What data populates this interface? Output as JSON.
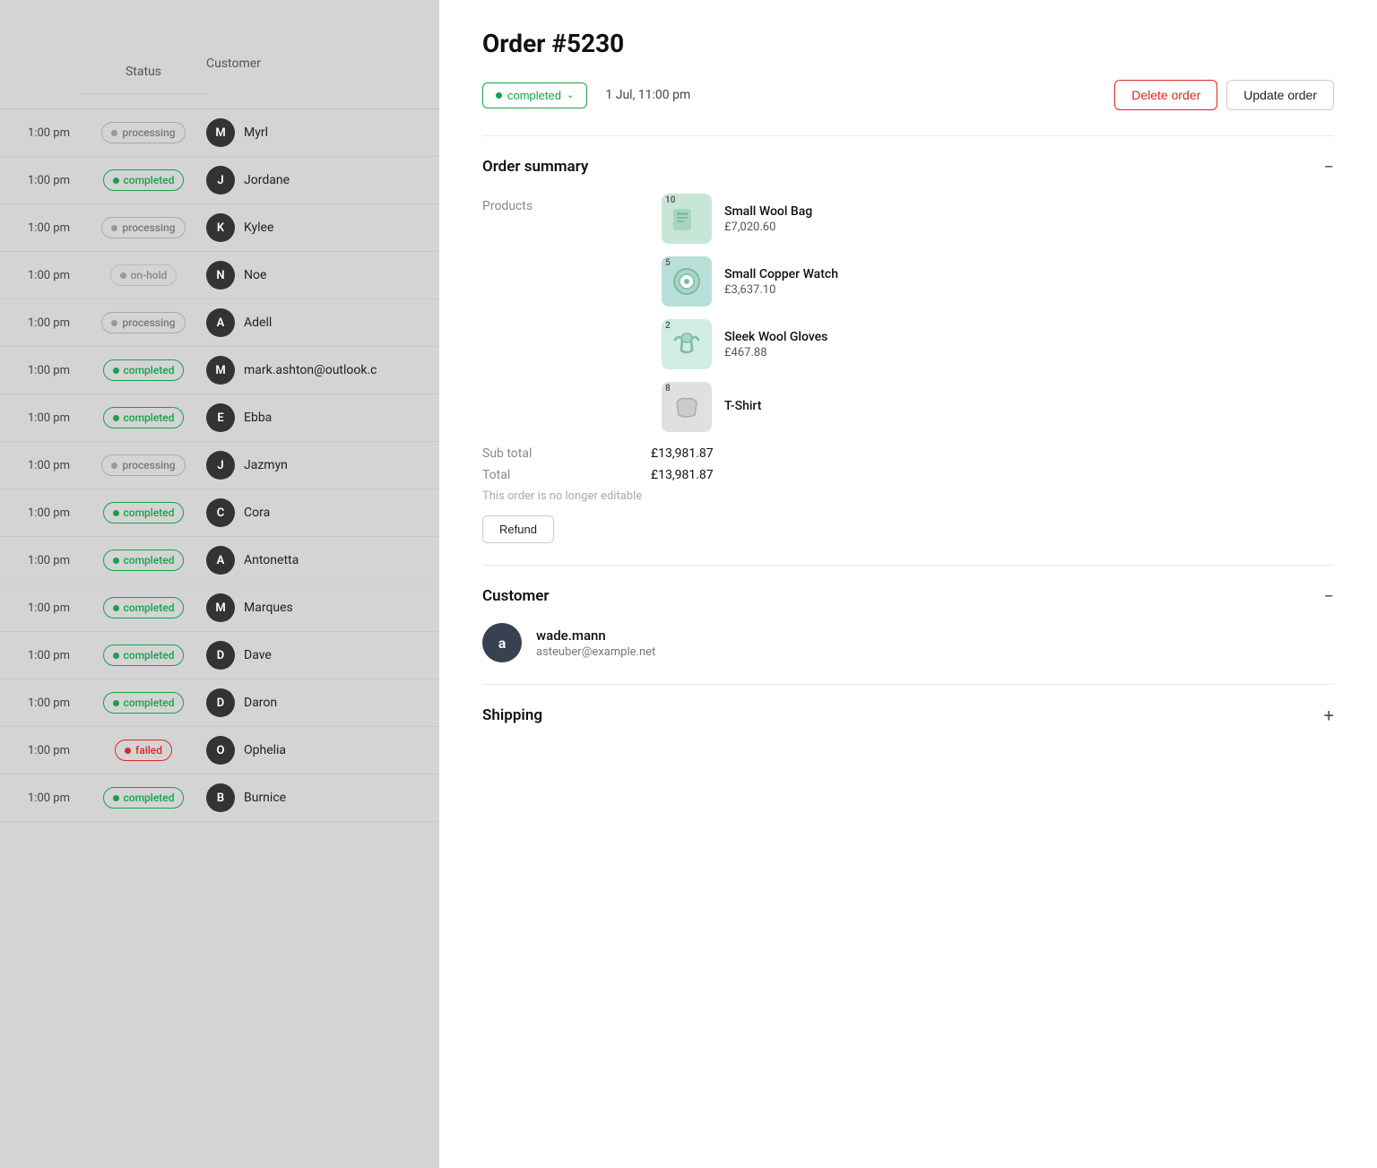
{
  "left": {
    "header": {
      "status_col": "Status",
      "customer_col": "Customer"
    },
    "rows": [
      {
        "time": "1:00 pm",
        "status": "processing",
        "dot": "gray",
        "customer_initial": "M",
        "customer_name": "Myrl"
      },
      {
        "time": "1:00 pm",
        "status": "completed",
        "dot": "green",
        "customer_initial": "J",
        "customer_name": "Jordane"
      },
      {
        "time": "1:00 pm",
        "status": "processing",
        "dot": "gray",
        "customer_initial": "K",
        "customer_name": "Kylee"
      },
      {
        "time": "1:00 pm",
        "status": "on-hold",
        "dot": "gray",
        "customer_initial": "N",
        "customer_name": "Noe"
      },
      {
        "time": "1:00 pm",
        "status": "processing",
        "dot": "gray",
        "customer_initial": "A",
        "customer_name": "Adell"
      },
      {
        "time": "1:00 pm",
        "status": "completed",
        "dot": "green",
        "customer_initial": "M",
        "customer_name": "mark.ashton@outlook.c"
      },
      {
        "time": "1:00 pm",
        "status": "completed",
        "dot": "green",
        "customer_initial": "E",
        "customer_name": "Ebba"
      },
      {
        "time": "1:00 pm",
        "status": "processing",
        "dot": "gray",
        "customer_initial": "J",
        "customer_name": "Jazmyn"
      },
      {
        "time": "1:00 pm",
        "status": "completed",
        "dot": "green",
        "customer_initial": "C",
        "customer_name": "Cora"
      },
      {
        "time": "1:00 pm",
        "status": "completed",
        "dot": "green",
        "customer_initial": "A",
        "customer_name": "Antonetta"
      },
      {
        "time": "1:00 pm",
        "status": "completed",
        "dot": "green",
        "customer_initial": "M",
        "customer_name": "Marques"
      },
      {
        "time": "1:00 pm",
        "status": "completed",
        "dot": "green",
        "customer_initial": "D",
        "customer_name": "Dave"
      },
      {
        "time": "1:00 pm",
        "status": "completed",
        "dot": "green",
        "customer_initial": "D",
        "customer_name": "Daron"
      },
      {
        "time": "1:00 pm",
        "status": "failed",
        "dot": "red",
        "customer_initial": "O",
        "customer_name": "Ophelia"
      },
      {
        "time": "1:00 pm",
        "status": "completed",
        "dot": "green",
        "customer_initial": "B",
        "customer_name": "Burnice"
      }
    ]
  },
  "right": {
    "order_title": "Order #5230",
    "status": "completed",
    "date": "1 Jul, 11:00 pm",
    "delete_btn": "Delete order",
    "update_btn": "Update order",
    "order_summary_title": "Order summary",
    "order_summary_toggle": "−",
    "products_label": "Products",
    "products": [
      {
        "qty": "10",
        "name": "Small Wool Bag",
        "price": "£7,020.60",
        "color": "#c8e6d8"
      },
      {
        "qty": "5",
        "name": "Small Copper Watch",
        "price": "£3,637.10",
        "color": "#b8e0d8"
      },
      {
        "qty": "2",
        "name": "Sleek Wool Gloves",
        "price": "£467.88",
        "color": "#d0ece4"
      },
      {
        "qty": "8",
        "name": "T-Shirt",
        "price": "",
        "color": "#e0e0e0"
      }
    ],
    "subtotal_label": "Sub total",
    "subtotal_value": "£13,981.87",
    "total_label": "Total",
    "total_value": "£13,981.87",
    "not_editable": "This order is no longer editable",
    "refund_btn": "Refund",
    "customer_title": "Customer",
    "customer_toggle": "−",
    "customer_initial": "a",
    "customer_name": "wade.mann",
    "customer_email": "asteuber@example.net",
    "shipping_title": "Shipping",
    "shipping_toggle": "+"
  }
}
